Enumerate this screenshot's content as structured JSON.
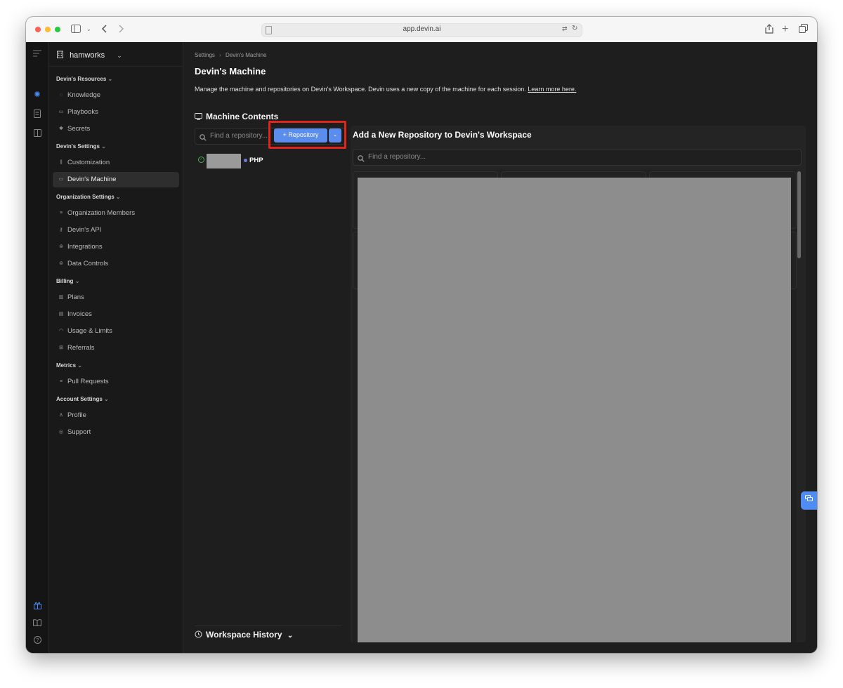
{
  "browser": {
    "url": "app.devin.ai"
  },
  "workspace": {
    "name": "hamworks"
  },
  "sidebar": {
    "sections": [
      {
        "title": "Devin's Resources",
        "items": [
          {
            "label": "Knowledge",
            "icon": "lightbulb-icon"
          },
          {
            "label": "Playbooks",
            "icon": "playbook-icon"
          },
          {
            "label": "Secrets",
            "icon": "key-icon"
          }
        ]
      },
      {
        "title": "Devin's Settings",
        "items": [
          {
            "label": "Customization",
            "icon": "sliders-icon"
          },
          {
            "label": "Devin's Machine",
            "icon": "monitor-icon",
            "active": true
          }
        ]
      },
      {
        "title": "Organization Settings",
        "items": [
          {
            "label": "Organization Members",
            "icon": "members-icon"
          },
          {
            "label": "Devin's API",
            "icon": "api-key-icon"
          },
          {
            "label": "Integrations",
            "icon": "integrations-icon"
          },
          {
            "label": "Data Controls",
            "icon": "database-icon"
          }
        ]
      },
      {
        "title": "Billing",
        "items": [
          {
            "label": "Plans",
            "icon": "map-icon"
          },
          {
            "label": "Invoices",
            "icon": "invoice-icon"
          },
          {
            "label": "Usage & Limits",
            "icon": "gauge-icon"
          },
          {
            "label": "Referrals",
            "icon": "gift-icon"
          }
        ]
      },
      {
        "title": "Metrics",
        "items": [
          {
            "label": "Pull Requests",
            "icon": "pull-request-icon"
          }
        ]
      },
      {
        "title": "Account Settings",
        "items": [
          {
            "label": "Profile",
            "icon": "user-icon"
          },
          {
            "label": "Support",
            "icon": "help-icon"
          }
        ]
      }
    ]
  },
  "main": {
    "breadcrumb": [
      "Settings",
      "Devin's Machine"
    ],
    "breadcrumb_sep": "›",
    "title": "Devin's Machine",
    "description": "Manage the machine and repositories on Devin's Workspace. Devin uses a new copy of the machine for each session.",
    "learn_more": "Learn more here.",
    "machine_contents": {
      "title": "Machine Contents",
      "search_placeholder": "Find a repository...",
      "add_button": "+ Repository",
      "repos": [
        {
          "language": "PHP",
          "status": "ready"
        }
      ]
    },
    "workspace_history": {
      "title": "Workspace History"
    },
    "add_repo_panel": {
      "title": "Add a New Repository to Devin's Workspace",
      "search_placeholder": "Find a repository..."
    }
  },
  "colors": {
    "accent": "#5b8def",
    "highlight": "#e0261c",
    "success": "#4caf50"
  }
}
